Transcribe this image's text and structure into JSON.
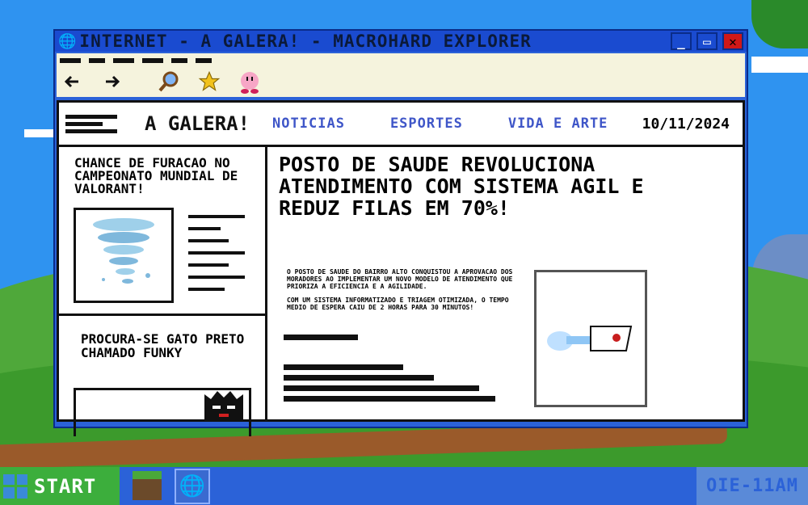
{
  "window": {
    "title": "INTERNET - A GALERA! - MACROHARD EXPLORER"
  },
  "site": {
    "brand": "A GALERA!",
    "nav": [
      "NOTICIAS",
      "ESPORTES",
      "VIDA E ARTE"
    ],
    "date": "10/11/2024"
  },
  "sidebar": {
    "story1_title": "CHANCE DE FURACAO NO CAMPEONATO MUNDIAL DE VALORANT!",
    "story2_title": "PROCURA-SE GATO PRETO CHAMADO FUNKY"
  },
  "article": {
    "headline": "POSTO DE SAUDE REVOLUCIONA ATENDIMENTO COM SISTEMA AGIL E REDUZ FILAS EM 70%!",
    "paragraph1": "O POSTO DE SAUDE DO BAIRRO ALTO CONQUISTOU A APROVACAO DOS MORADORES AO IMPLEMENTAR UM NOVO MODELO DE ATENDIMENTO QUE PRIORIZA A EFICIENCIA E A AGILIDADE.",
    "paragraph2": "COM UM SISTEMA INFORMATIZADO E TRIAGEM OTIMIZADA, O TEMPO MEDIO DE ESPERA CAIU DE 2 HORAS PARA 30 MINUTOS!"
  },
  "icons": {
    "back": "back-arrow-icon",
    "forward": "forward-arrow-icon",
    "search": "magnifier-icon",
    "favorites": "star-icon",
    "character": "kirby-icon"
  },
  "taskbar": {
    "start_label": "START",
    "clock": "OIE-11AM"
  },
  "colors": {
    "titlebar": "#1a4bd0",
    "nav_link": "#3f56c8",
    "toolbar_bg": "#f5f3dd",
    "start_green": "#3cae3c"
  }
}
